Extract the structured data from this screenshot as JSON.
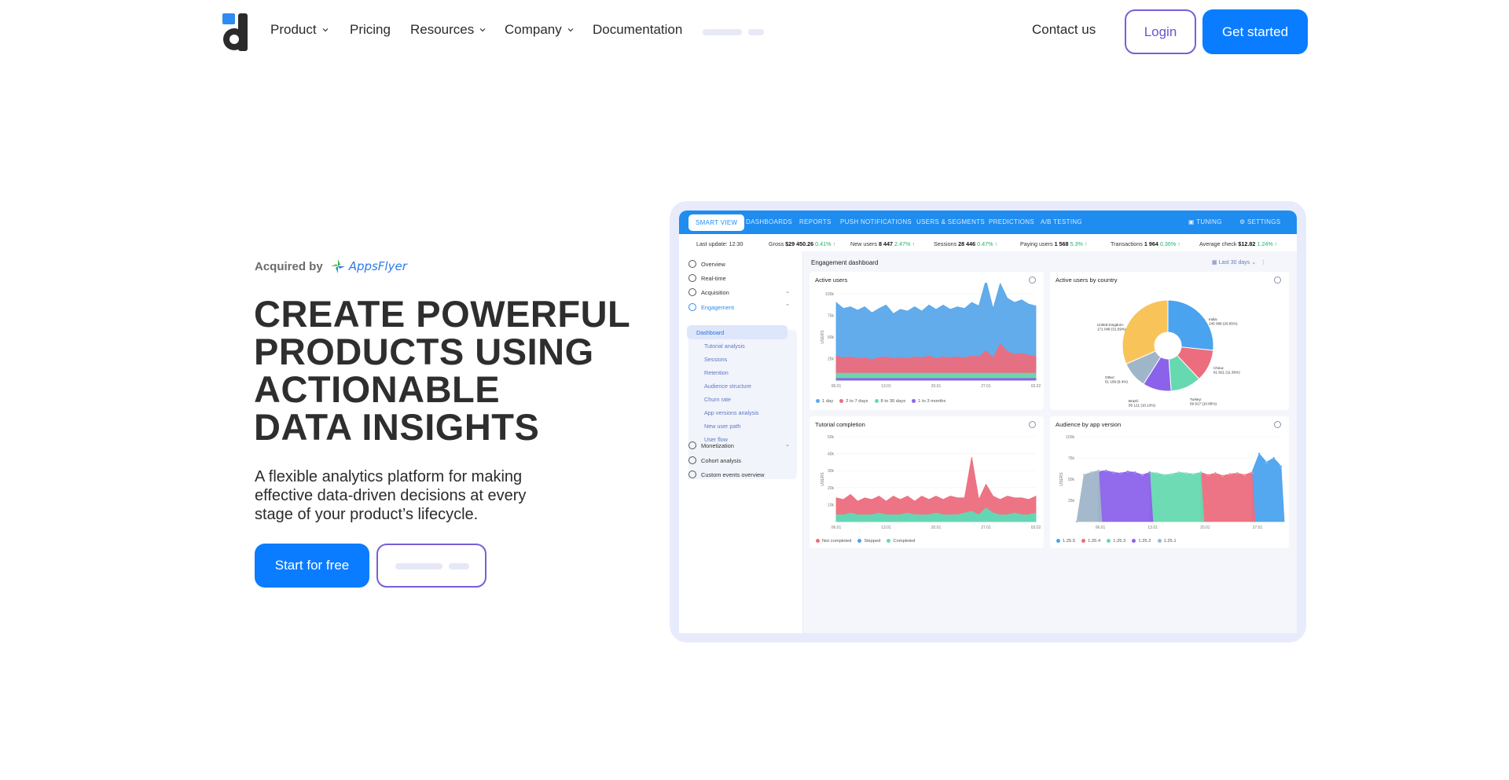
{
  "nav": {
    "items": [
      {
        "label": "Product",
        "has_dropdown": true
      },
      {
        "label": "Pricing",
        "has_dropdown": false
      },
      {
        "label": "Resources",
        "has_dropdown": true
      },
      {
        "label": "Company",
        "has_dropdown": true
      },
      {
        "label": "Documentation",
        "has_dropdown": false
      }
    ],
    "contact": "Contact us",
    "login": "Login",
    "get_started": "Get started"
  },
  "hero": {
    "acquired_label": "Acquired by",
    "acquirer": "AppsFlyer",
    "headline_lines": [
      "CREATE POWERFUL",
      "PRODUCTS USING",
      "ACTIONABLE",
      "DATA INSIGHTS"
    ],
    "subtitle_lines": [
      "A flexible analytics platform for making",
      "effective data-driven decisions at every",
      "stage of your product’s lifecycle."
    ],
    "cta_primary": "Start for free"
  },
  "dashboard": {
    "tabs": [
      "SMART VIEW",
      "DASHBOARDS",
      "REPORTS",
      "PUSH NOTIFICATIONS",
      "USERS & SEGMENTS",
      "PREDICTIONS",
      "A/B TESTING"
    ],
    "tabs_right": [
      "TUNING",
      "SETTINGS"
    ],
    "stats": [
      {
        "label": "Last update: 12:30",
        "value": "",
        "delta": ""
      },
      {
        "label": "Gross",
        "value": "$29 450.26",
        "delta": "0.41% ↑"
      },
      {
        "label": "New users",
        "value": "8 447",
        "delta": "2.47% ↑"
      },
      {
        "label": "Sessions",
        "value": "28 446",
        "delta": "0.47% ↑"
      },
      {
        "label": "Paying users",
        "value": "1 568",
        "delta": "5.3% ↑"
      },
      {
        "label": "Transactions",
        "value": "1 964",
        "delta": "0.36% ↑"
      },
      {
        "label": "Average check",
        "value": "$12.82",
        "delta": "1.24% ↑"
      }
    ],
    "sidebar": {
      "items": [
        "Overview",
        "Real-time",
        "Acquisition",
        "Engagement",
        "Monetization",
        "Cohort analysis",
        "Custom events overview"
      ],
      "sub_items": [
        "Dashboard",
        "Tutorial analysis",
        "Sessions",
        "Retention",
        "Audience structure",
        "Churn rate",
        "App versions analysis",
        "New user path",
        "User flow"
      ]
    },
    "title": "Engagement dashboard",
    "range": "Last 30 days",
    "colors": {
      "blue": "#5aa8ea",
      "red": "#ec6d7e",
      "green": "#66d9b0",
      "purple": "#8b63ea",
      "yellow": "#f8c45a",
      "grey": "#9fb6c9"
    }
  },
  "chart_data": [
    {
      "type": "area",
      "title": "Active users",
      "ylabel": "USERS",
      "yticks": [
        "100k",
        "75k",
        "50k",
        "25k"
      ],
      "xticks": [
        "06.01",
        "13.01",
        "20.01",
        "27.01",
        "03.02"
      ],
      "ylim": [
        0,
        100
      ],
      "series": [
        {
          "name": "1 day",
          "color": "#5aa8ea",
          "values": [
            62,
            57,
            58,
            56,
            59,
            54,
            57,
            60,
            52,
            56,
            55,
            58,
            54,
            59,
            57,
            60,
            56,
            58,
            57,
            62,
            59,
            82,
            57,
            70,
            62,
            60,
            62,
            59,
            58
          ]
        },
        {
          "name": "2 to 7 days",
          "color": "#ec6d7e",
          "values": [
            20,
            18,
            19,
            17,
            18,
            16,
            18,
            19,
            17,
            18,
            17,
            19,
            18,
            20,
            17,
            19,
            18,
            19,
            18,
            20,
            19,
            26,
            18,
            34,
            25,
            22,
            23,
            21,
            20
          ]
        },
        {
          "name": "8 to 30 days",
          "color": "#66d9b0",
          "values": [
            6,
            6,
            6,
            6,
            6,
            6,
            6,
            6,
            6,
            6,
            6,
            6,
            6,
            6,
            6,
            6,
            6,
            6,
            6,
            6,
            6,
            6,
            6,
            6,
            6,
            6,
            6,
            6,
            6
          ]
        },
        {
          "name": "1 to 3 months",
          "color": "#8b63ea",
          "values": [
            2,
            2,
            2,
            2,
            2,
            2,
            2,
            2,
            2,
            2,
            2,
            2,
            2,
            2,
            2,
            2,
            2,
            2,
            2,
            2,
            2,
            2,
            2,
            2,
            2,
            2,
            2,
            2,
            2
          ]
        }
      ]
    },
    {
      "type": "pie",
      "title": "Active users by country",
      "slices": [
        {
          "label": "India",
          "value_text": "145 068 (26.65%)",
          "value": 26.65,
          "color": "#4aa3ee"
        },
        {
          "label": "China",
          "value_text": "61 821 (11.36%)",
          "value": 11.36,
          "color": "#ec6d7e"
        },
        {
          "label": "Turkey",
          "value_text": "59 917 (10.85%)",
          "value": 10.85,
          "color": "#66d9b0"
        },
        {
          "label": "Brazil",
          "value_text": "55 121 (10.13%)",
          "value": 10.13,
          "color": "#8b63ea"
        },
        {
          "label": "Other",
          "value_text": "51 189 (9.4%)",
          "value": 9.4,
          "color": "#9fb6c9"
        },
        {
          "label": "United Kingdom",
          "value_text": "171 048 (31.59%)",
          "value": 31.59,
          "color": "#f8c45a"
        }
      ]
    },
    {
      "type": "area",
      "title": "Tutorial completion",
      "ylabel": "USERS",
      "yticks": [
        "50k",
        "40k",
        "30k",
        "20k",
        "10k"
      ],
      "xticks": [
        "06.01",
        "13.01",
        "20.01",
        "27.01",
        "03.02"
      ],
      "ylim": [
        0,
        50
      ],
      "series": [
        {
          "name": "Not completed",
          "color": "#ec6d7e",
          "values": [
            10,
            9,
            11,
            8,
            10,
            9,
            10,
            8,
            11,
            9,
            10,
            8,
            11,
            9,
            10,
            9,
            11,
            10,
            9,
            32,
            9,
            14,
            10,
            9,
            11,
            9,
            10,
            9,
            10
          ]
        },
        {
          "name": "Skipped",
          "color": "#4aa3ee",
          "values": [
            0,
            0,
            0,
            0,
            0,
            0,
            0,
            0,
            0,
            0,
            0,
            0,
            0,
            0,
            0,
            0,
            0,
            0,
            0,
            0,
            0,
            0,
            0,
            0,
            0,
            0,
            0,
            0,
            0
          ]
        },
        {
          "name": "Completed",
          "color": "#66d9b0",
          "values": [
            4,
            4,
            5,
            4,
            4,
            4,
            5,
            4,
            4,
            4,
            5,
            4,
            4,
            4,
            5,
            4,
            4,
            4,
            5,
            6,
            4,
            8,
            5,
            4,
            4,
            5,
            4,
            4,
            5
          ]
        }
      ]
    },
    {
      "type": "area",
      "title": "Audience by app version",
      "ylabel": "USERS",
      "yticks": [
        "100k",
        "75k",
        "50k",
        "25k"
      ],
      "xticks": [
        "06.01",
        "13.01",
        "20.01",
        "27.01"
      ],
      "ylim": [
        0,
        100
      ],
      "series": [
        {
          "name": "1.25.5",
          "color": "#4aa3ee",
          "values": [
            null,
            null,
            null,
            null,
            null,
            null,
            null,
            null,
            null,
            null,
            null,
            null,
            null,
            null,
            null,
            null,
            null,
            null,
            null,
            null,
            null,
            null,
            null,
            null,
            58,
            80,
            70,
            75,
            65
          ]
        },
        {
          "name": "1.25.4",
          "color": "#ec6d7e",
          "values": [
            null,
            null,
            null,
            null,
            null,
            null,
            null,
            null,
            null,
            null,
            null,
            null,
            null,
            null,
            null,
            null,
            null,
            58,
            55,
            57,
            54,
            56,
            57,
            55,
            58,
            null,
            null,
            null,
            null
          ]
        },
        {
          "name": "1.25.3",
          "color": "#66d9b0",
          "values": [
            null,
            null,
            null,
            null,
            null,
            null,
            null,
            null,
            null,
            null,
            58,
            57,
            55,
            56,
            58,
            57,
            56,
            58,
            null,
            null,
            null,
            null,
            null,
            null,
            null,
            null,
            null,
            null,
            null
          ]
        },
        {
          "name": "1.25.2",
          "color": "#8b63ea",
          "values": [
            null,
            null,
            null,
            59,
            60,
            58,
            57,
            59,
            58,
            55,
            58,
            null,
            null,
            null,
            null,
            null,
            null,
            null,
            null,
            null,
            null,
            null,
            null,
            null,
            null,
            null,
            null,
            null,
            null
          ]
        },
        {
          "name": "1.25.1",
          "color": "#9fb6c9",
          "values": [
            0,
            55,
            58,
            60,
            null,
            null,
            null,
            null,
            null,
            null,
            null,
            null,
            null,
            null,
            null,
            null,
            null,
            null,
            null,
            null,
            null,
            null,
            null,
            null,
            null,
            null,
            null,
            null,
            null
          ]
        }
      ]
    }
  ]
}
